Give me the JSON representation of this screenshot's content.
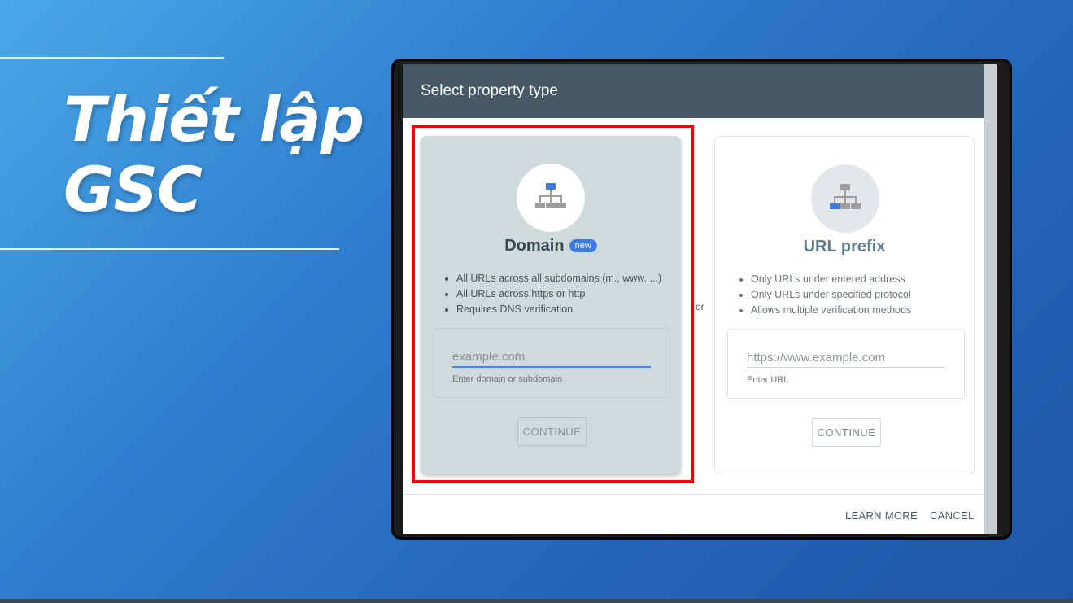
{
  "slide": {
    "title_line1": "Thiết lập",
    "title_line2": "GSC"
  },
  "dialog": {
    "title": "Select property type",
    "or_label": "or",
    "domain_card": {
      "title": "Domain",
      "badge": "new",
      "bullets": [
        "All URLs across all subdomains (m., www. ...)",
        "All URLs across https or http",
        "Requires DNS verification"
      ],
      "input_placeholder": "example.com",
      "input_help": "Enter domain or subdomain",
      "continue_label": "CONTINUE"
    },
    "prefix_card": {
      "title": "URL prefix",
      "bullets": [
        "Only URLs under entered address",
        "Only URLs under specified protocol",
        "Allows multiple verification methods"
      ],
      "input_placeholder": "https://www.example.com",
      "input_help": "Enter URL",
      "continue_label": "CONTINUE"
    },
    "footer": {
      "learn_more": "LEARN MORE",
      "cancel": "CANCEL"
    }
  },
  "colors": {
    "header_bg": "#455a64",
    "highlight": "#ee0000",
    "badge": "#3d7be0",
    "icon_blue": "#3d7be0",
    "icon_gray": "#9e9e9e"
  }
}
